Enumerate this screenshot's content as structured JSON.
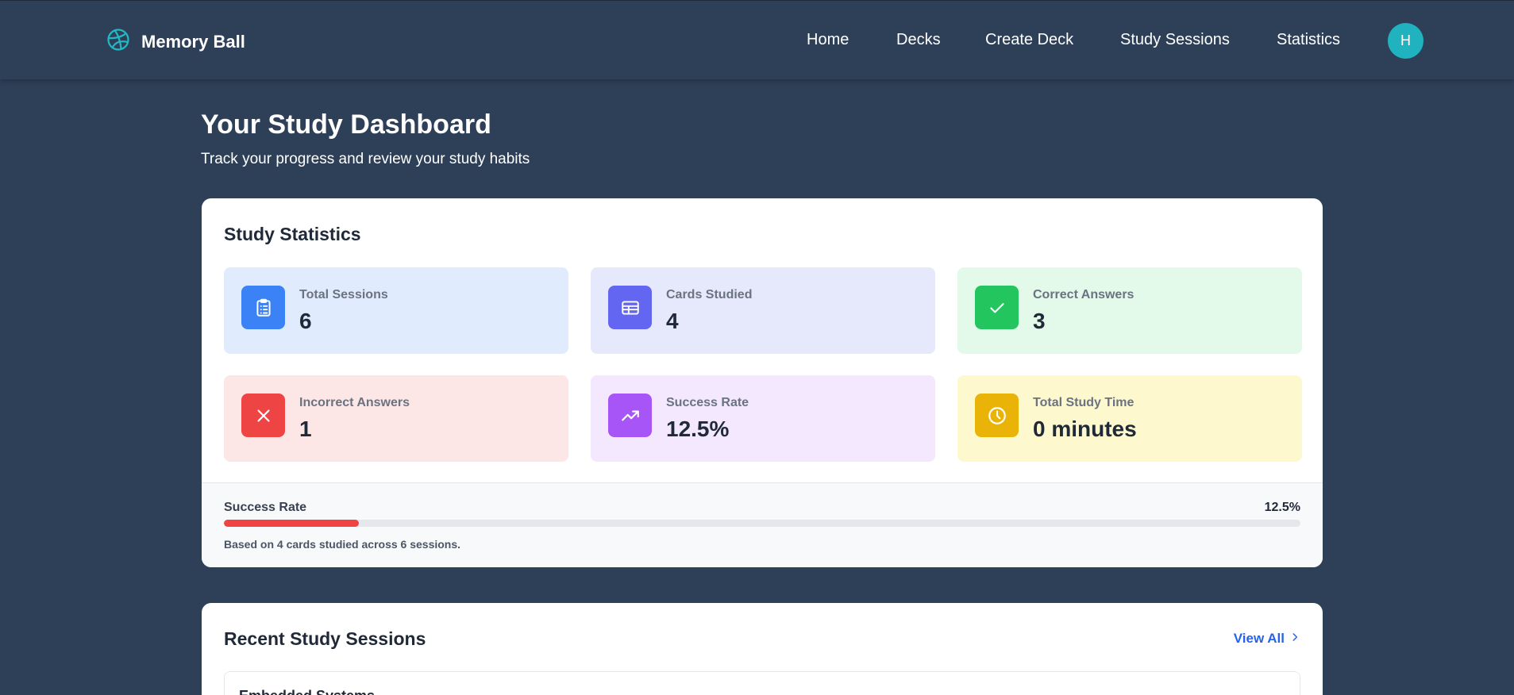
{
  "navbar": {
    "brand": "Memory Ball",
    "links": [
      "Home",
      "Decks",
      "Create Deck",
      "Study Sessions",
      "Statistics"
    ],
    "avatar_initial": "H"
  },
  "header": {
    "title": "Your Study Dashboard",
    "subtitle": "Track your progress and review your study habits"
  },
  "stats": {
    "title": "Study Statistics",
    "tiles": [
      {
        "label": "Total Sessions",
        "value": "6",
        "icon": "clipboard-list-icon",
        "color": "#3b82f6",
        "bg": "#e0ecfd"
      },
      {
        "label": "Cards Studied",
        "value": "4",
        "icon": "table-icon",
        "color": "#6366f1",
        "bg": "#e6e9fb"
      },
      {
        "label": "Correct Answers",
        "value": "3",
        "icon": "check-icon",
        "color": "#22c55e",
        "bg": "#e3f9ea"
      },
      {
        "label": "Incorrect Answers",
        "value": "1",
        "icon": "x-icon",
        "color": "#ef4444",
        "bg": "#fde6e6"
      },
      {
        "label": "Success Rate",
        "value": "12.5%",
        "icon": "trending-up-icon",
        "color": "#a855f7",
        "bg": "#f3e8fd"
      },
      {
        "label": "Total Study Time",
        "value": "0 minutes",
        "icon": "clock-icon",
        "color": "#eab308",
        "bg": "#fef8cf"
      }
    ],
    "rate": {
      "label": "Success Rate",
      "value": "12.5%",
      "fraction": 0.125,
      "note": "Based on 4 cards studied across 6 sessions."
    }
  },
  "recent": {
    "title": "Recent Study Sessions",
    "view_all": "View All",
    "first_session": "Embedded Systems"
  }
}
